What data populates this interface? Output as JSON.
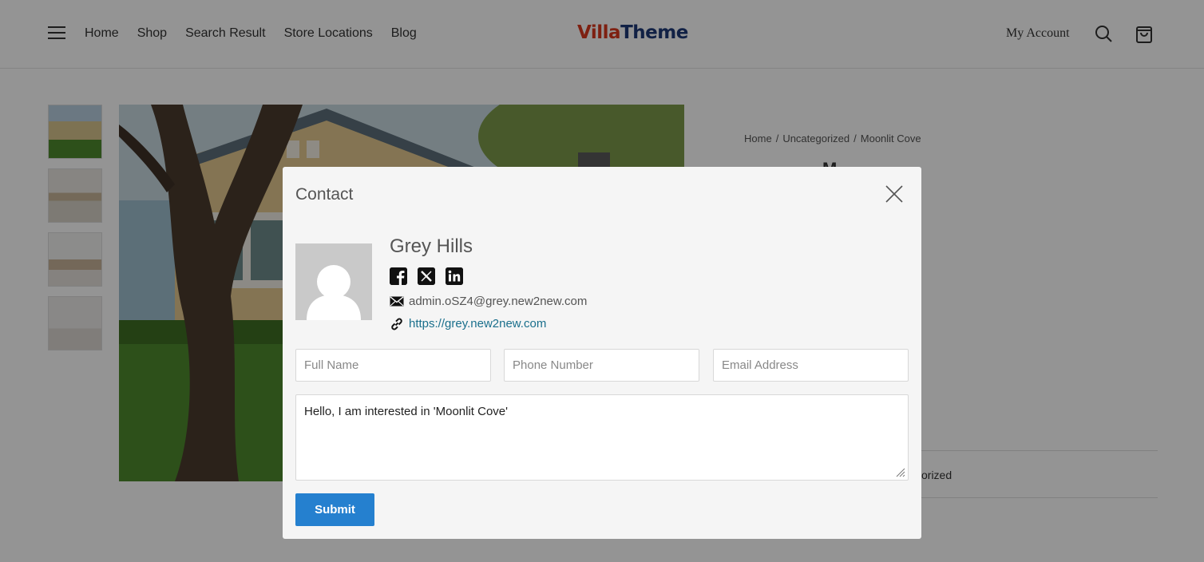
{
  "header": {
    "nav": [
      "Home",
      "Shop",
      "Search Result",
      "Store Locations",
      "Blog"
    ],
    "logo_part1": "Villa",
    "logo_part2": "Theme",
    "my_account": "My Account"
  },
  "breadcrumb": [
    "Home",
    "Uncategorized",
    "Moonlit Cove"
  ],
  "category_peek": "orized",
  "modal": {
    "title": "Contact",
    "agent": {
      "name": "Grey Hills",
      "email": "admin.oSZ4@grey.new2new.com",
      "url": "https://grey.new2new.com",
      "socials": [
        "facebook-icon",
        "x-icon",
        "linkedin-icon"
      ]
    },
    "form": {
      "full_name_placeholder": "Full Name",
      "phone_placeholder": "Phone Number",
      "email_placeholder": "Email Address",
      "message_value": "Hello, I am interested in 'Moonlit Cove'",
      "submit_label": "Submit"
    }
  },
  "colors": {
    "submit": "#2580cf",
    "link": "#1a6f8c",
    "logo_red": "#d9381e",
    "logo_blue": "#1e3a78",
    "overlay": "rgba(0,0,0,0.42)"
  }
}
